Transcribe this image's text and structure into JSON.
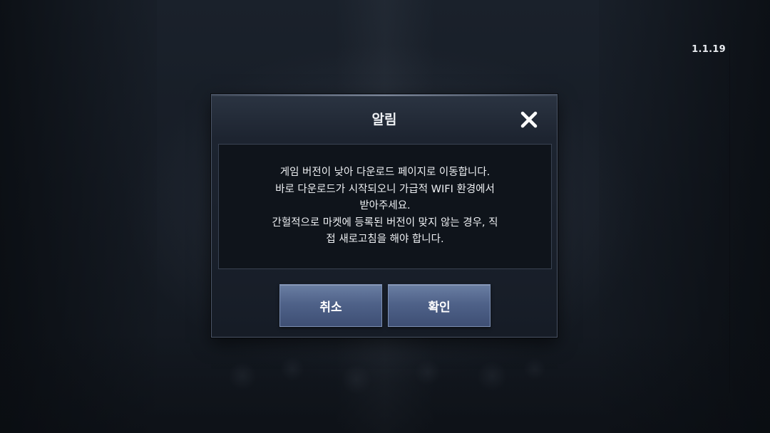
{
  "version": "1.1.19",
  "dialog": {
    "title": "알림",
    "close_icon": "close-icon",
    "message_lines": [
      "게임 버전이 낮아 다운로드 페이지로 이동합니다.",
      "바로 다운로드가 시작되오니 가급적 WIFI 환경에서",
      "받아주세요.",
      "간헐적으로 마켓에 등록된 버전이 맞지 않는 경우, 직",
      "접 새로고침을 해야 합니다."
    ],
    "cancel_label": "취소",
    "confirm_label": "확인"
  },
  "colors": {
    "button": "#4f6289",
    "panel": "#0f141b",
    "text": "#eef0f3"
  }
}
